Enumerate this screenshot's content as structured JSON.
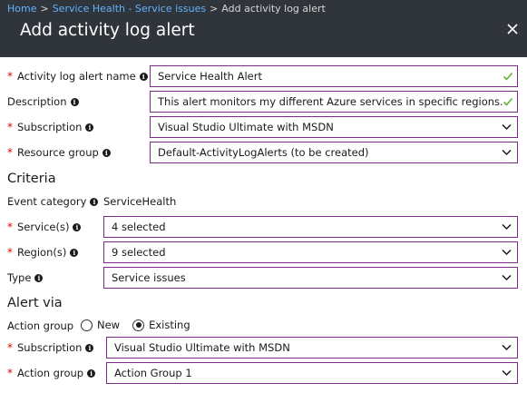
{
  "breadcrumb": {
    "home": "Home",
    "service_health": "Service Health - Service issues",
    "current": "Add activity log alert",
    "separator": ">"
  },
  "blade": {
    "title": "Add activity log alert",
    "close_icon": "close-icon"
  },
  "form": {
    "alert_name": {
      "label": "Activity log alert name",
      "value": "Service Health Alert"
    },
    "description": {
      "label": "Description",
      "value": "This alert monitors my different Azure services in specific regions."
    },
    "subscription": {
      "label": "Subscription",
      "value": "Visual Studio Ultimate with MSDN"
    },
    "resource_group": {
      "label": "Resource group",
      "value": "Default-ActivityLogAlerts (to be created)"
    }
  },
  "criteria": {
    "heading": "Criteria",
    "event_category": {
      "label": "Event category",
      "value": "ServiceHealth"
    },
    "services": {
      "label": "Service(s)",
      "value": "4 selected"
    },
    "regions": {
      "label": "Region(s)",
      "value": "9 selected"
    },
    "type": {
      "label": "Type",
      "value": "Service issues"
    }
  },
  "alert_via": {
    "heading": "Alert via",
    "action_group": {
      "label": "Action group",
      "option_new": "New",
      "option_existing": "Existing",
      "selected": "Existing"
    },
    "subscription": {
      "label": "Subscription",
      "value": "Visual Studio Ultimate with MSDN"
    },
    "action_group_select": {
      "label": "Action group",
      "value": "Action Group 1"
    }
  },
  "required_mark": "*",
  "info_glyph": "i",
  "colors": {
    "header_bg": "#30353b",
    "link": "#5fb3ff",
    "field_border": "#7d2a8a",
    "check": "#5fb23a",
    "required": "#e00000"
  }
}
